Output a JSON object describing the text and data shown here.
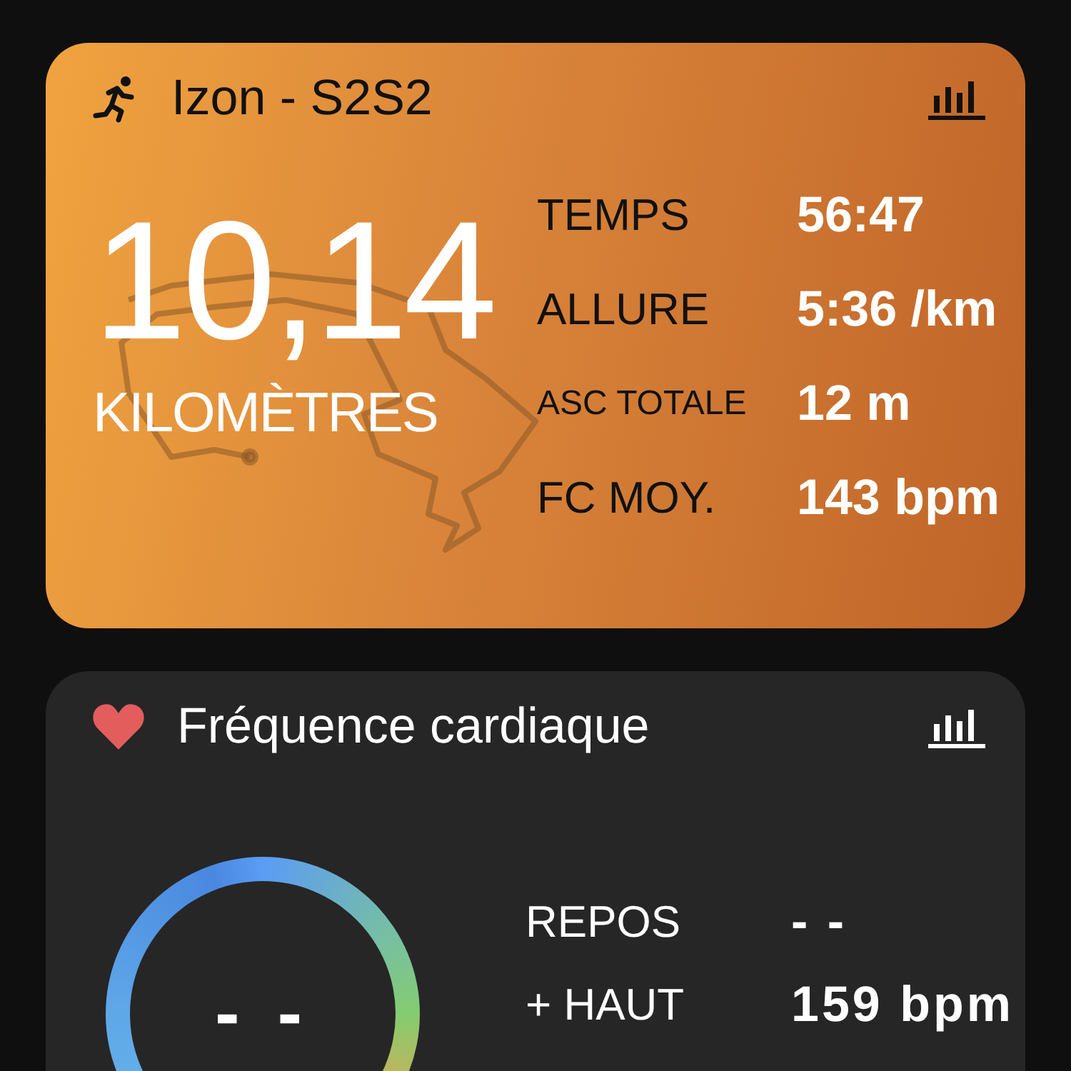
{
  "activity_card": {
    "title": "Izon - S2S2",
    "distance": "10,14",
    "unit": "KILOMÈTRES",
    "stats": [
      {
        "label": "TEMPS",
        "value": "56:47",
        "kind": "normal"
      },
      {
        "label": "ALLURE",
        "value": "5:36 /km",
        "kind": "normal"
      },
      {
        "label": "ASC TOTALE",
        "value": "12 m",
        "kind": "small"
      },
      {
        "label": "FC MOY.",
        "value": "143 bpm",
        "kind": "normal"
      }
    ]
  },
  "heart_rate_card": {
    "title": "Fréquence cardiaque",
    "gauge_value": "- -",
    "stats": [
      {
        "label": "REPOS",
        "value": "- -"
      },
      {
        "label": "+ HAUT",
        "value": "159 bpm"
      }
    ]
  }
}
